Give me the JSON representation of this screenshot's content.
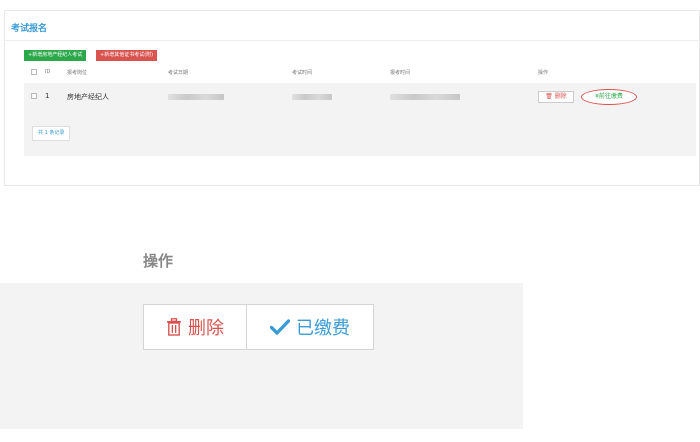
{
  "panel": {
    "title": "考试报名",
    "btn_add_estate": "+新增房地产经纪人考试",
    "btn_add_other": "+新增其他证书考试(附)"
  },
  "table": {
    "headers": {
      "id": "ID",
      "position": "报考岗位",
      "exam_date": "考试日期",
      "exam_time": "考试时间",
      "register_time": "报考时间",
      "actions": "操作"
    },
    "rows": [
      {
        "id": "1",
        "position": "房地产经纪人"
      }
    ],
    "delete_label": "删除",
    "pay_label": "前往缴费",
    "record_count": "共 1 条记录"
  },
  "zoom": {
    "header": "操作",
    "delete_label": "删除",
    "paid_label": "已缴费"
  },
  "colors": {
    "accent_blue": "#3a9bd5",
    "green": "#2aa84a",
    "red": "#d9534f"
  },
  "icons": {
    "delete": "trash-icon",
    "pay": "yen-icon",
    "paid": "check-icon"
  }
}
